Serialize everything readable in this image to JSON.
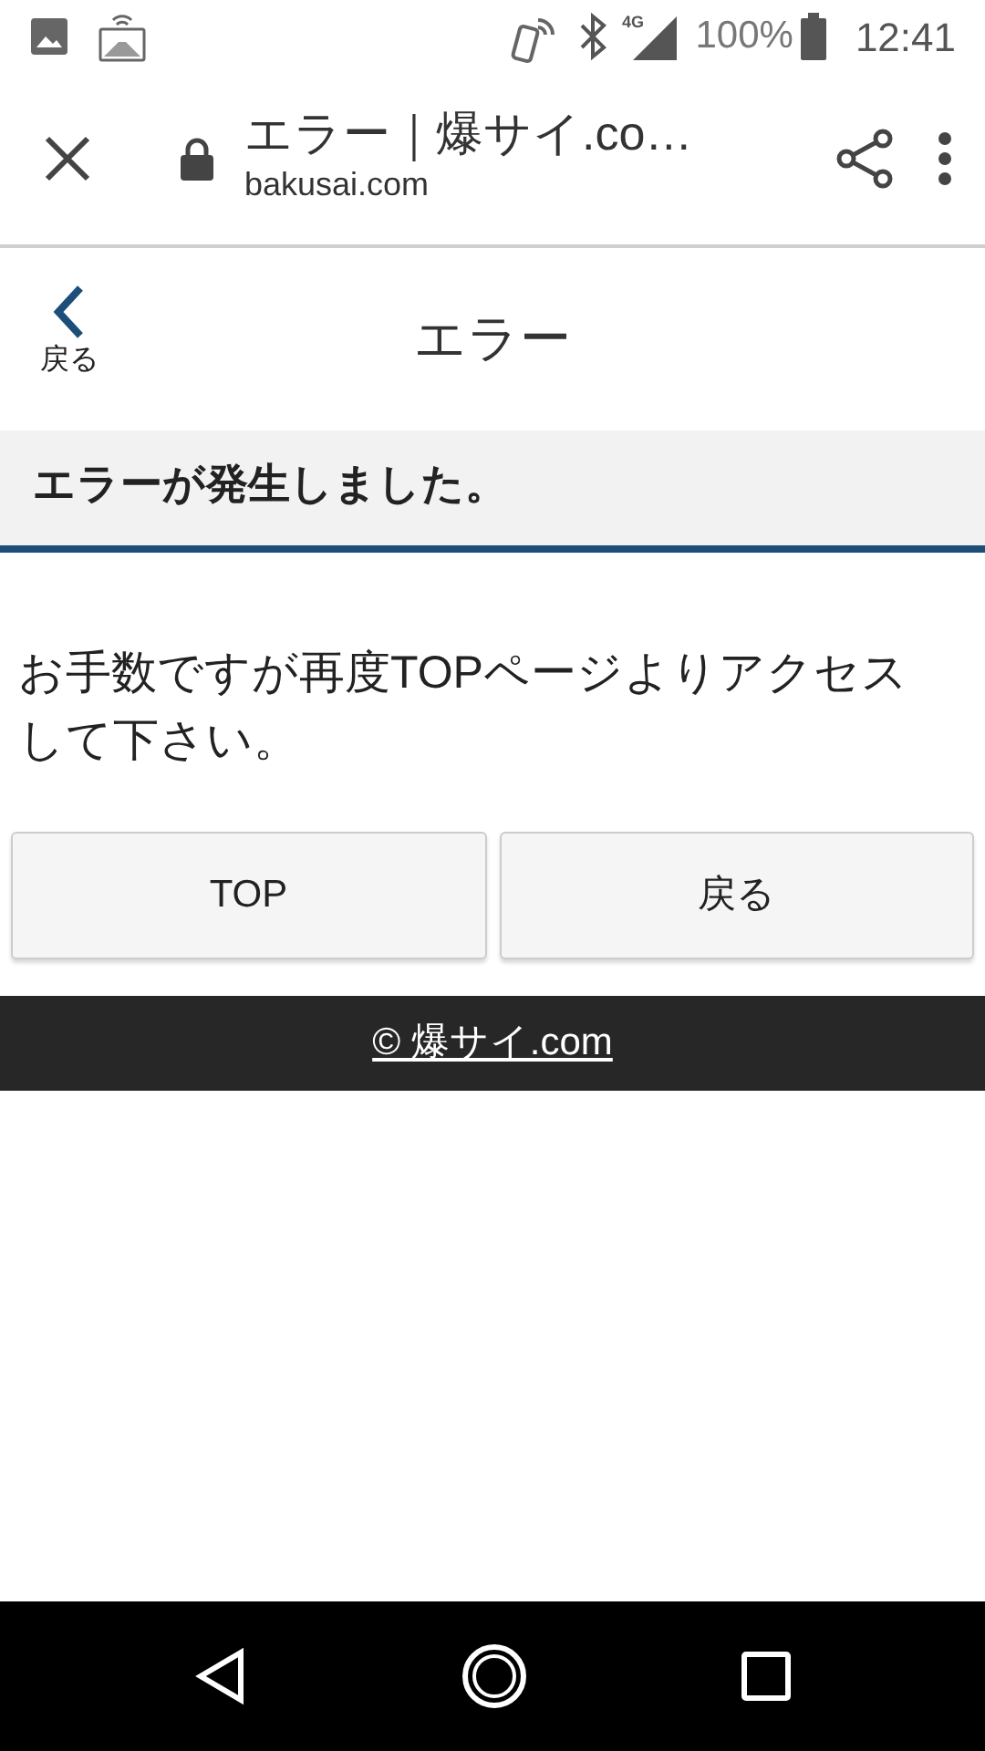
{
  "status_bar": {
    "network": "4G",
    "battery": "100%",
    "time": "12:41"
  },
  "browser": {
    "title": "エラー｜爆サイ.co…",
    "url": "bakusai.com"
  },
  "header": {
    "back_label": "戻る",
    "title": "エラー"
  },
  "heading": "エラーが発生しました。",
  "message": "お手数ですが再度TOPページよりアクセスして下さい。",
  "buttons": [
    "TOP",
    "戻る"
  ],
  "footer": "© 爆サイ.com"
}
